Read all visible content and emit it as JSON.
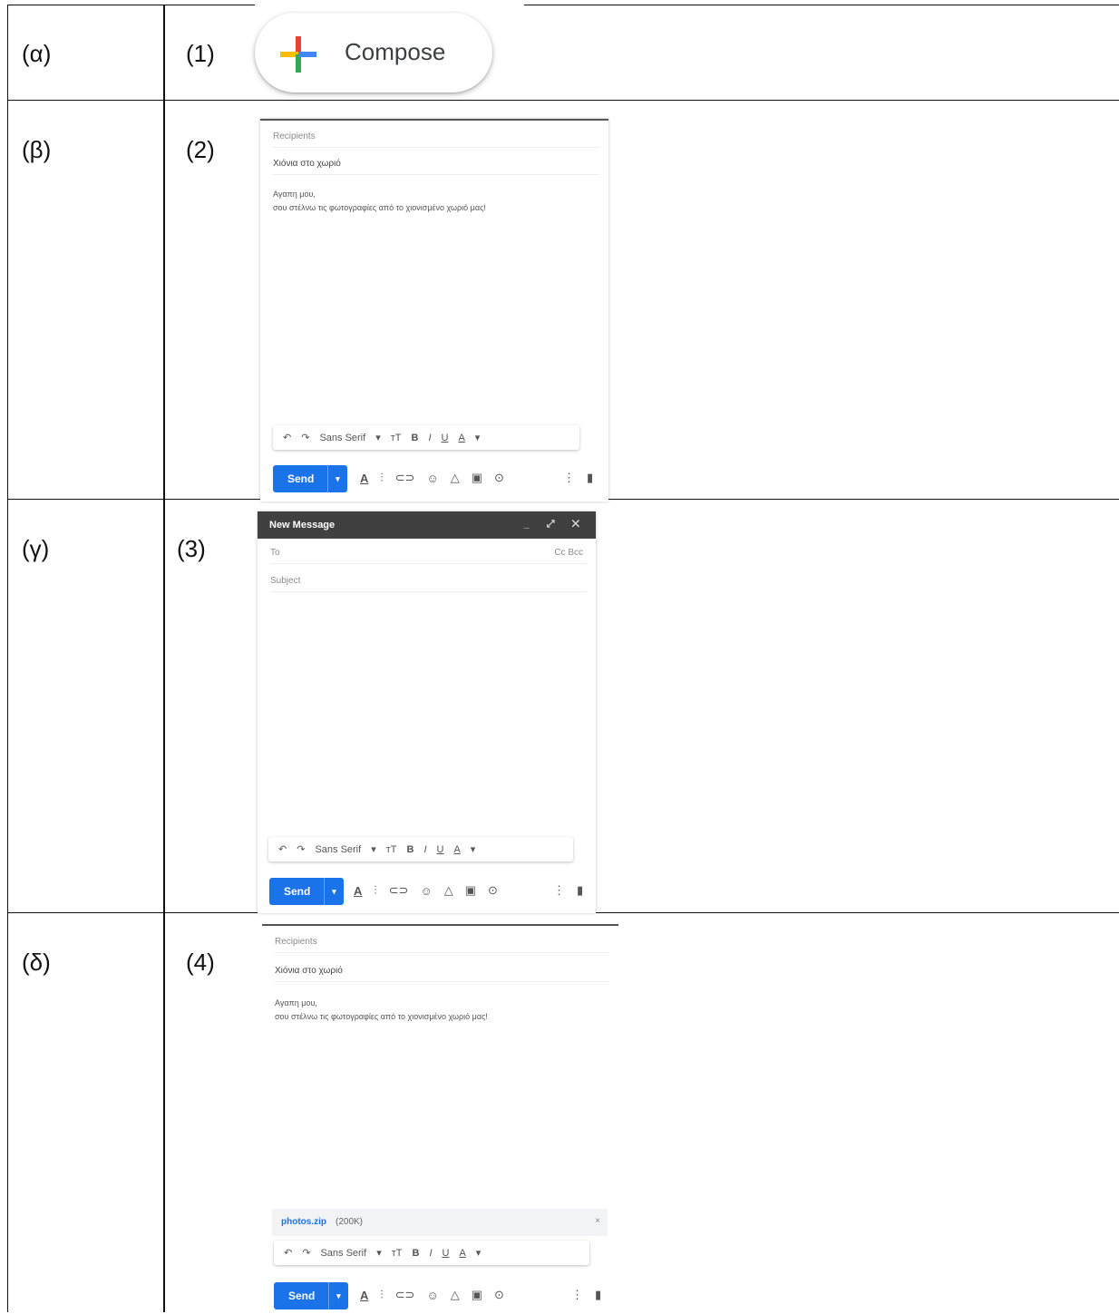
{
  "rows": [
    {
      "letter": "(α)",
      "number": "(1)"
    },
    {
      "letter": "(β)",
      "number": "(2)"
    },
    {
      "letter": "(γ)",
      "number": "(3)"
    },
    {
      "letter": "(δ)",
      "number": "(4)"
    }
  ],
  "compose": {
    "label": "Compose"
  },
  "panel2": {
    "recipients": "Recipients",
    "subject": "Χιόνια στο χωριό",
    "body_line1": "Αγαπη μου,",
    "body_line2": "σου στέλνω τις φωτογραφίες από το χιονισμένο χωριό μας!"
  },
  "panel3": {
    "title": "New Message",
    "to": "To",
    "cc_bcc": "Cc Bcc",
    "subject": "Subject"
  },
  "panel4": {
    "recipients": "Recipients",
    "subject": "Χιόνια στο χωριό",
    "body_line1": "Αγαπη μου,",
    "body_line2": "σου στέλνω τις φωτογραφίες από το χιονισμένο χωριό μας!",
    "attachment_name": "photos.zip",
    "attachment_size": "(200K)"
  },
  "toolbar": {
    "undo": "↶",
    "redo": "↷",
    "font": "Sans Serif",
    "font_caret": "▾",
    "size": "ᴛT",
    "bold": "B",
    "italic": "I",
    "underline": "U",
    "text_color": "A",
    "more": "▾"
  },
  "send": {
    "label": "Send",
    "caret": "▾"
  },
  "icons": [
    "format-icon",
    "attach-icon",
    "link-icon",
    "emoji-icon",
    "drive-icon",
    "photo-icon",
    "lock-icon",
    "more-options-icon",
    "trash-icon"
  ],
  "colors": {
    "send_blue": "#1a73e8",
    "titlebar": "#404040"
  }
}
